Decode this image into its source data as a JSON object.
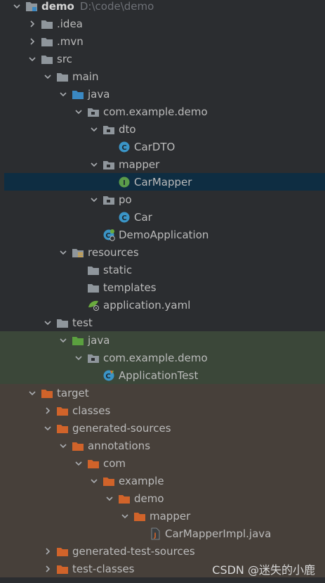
{
  "tree": [
    {
      "name": "project-root",
      "label": "demo",
      "path": "D:\\code\\demo",
      "indent": 0,
      "state": "open",
      "icon": "project-folder",
      "bold": true
    },
    {
      "name": "folder-idea",
      "label": ".idea",
      "indent": 1,
      "state": "closed",
      "icon": "folder"
    },
    {
      "name": "folder-mvn",
      "label": ".mvn",
      "indent": 1,
      "state": "closed",
      "icon": "folder"
    },
    {
      "name": "folder-src",
      "label": "src",
      "indent": 1,
      "state": "open",
      "icon": "folder"
    },
    {
      "name": "folder-main",
      "label": "main",
      "indent": 2,
      "state": "open",
      "icon": "folder"
    },
    {
      "name": "folder-java",
      "label": "java",
      "indent": 3,
      "state": "open",
      "icon": "source-folder"
    },
    {
      "name": "package-com-example-demo",
      "label": "com.example.demo",
      "indent": 4,
      "state": "open",
      "icon": "package"
    },
    {
      "name": "package-dto",
      "label": "dto",
      "indent": 5,
      "state": "open",
      "icon": "package"
    },
    {
      "name": "file-cardto",
      "label": "CarDTO",
      "indent": 6,
      "state": "none",
      "icon": "class"
    },
    {
      "name": "package-mapper",
      "label": "mapper",
      "indent": 5,
      "state": "open",
      "icon": "package"
    },
    {
      "name": "file-carmapper",
      "label": "CarMapper",
      "indent": 6,
      "state": "none",
      "icon": "interface",
      "selected": true
    },
    {
      "name": "package-po",
      "label": "po",
      "indent": 5,
      "state": "open",
      "icon": "package"
    },
    {
      "name": "file-car",
      "label": "Car",
      "indent": 6,
      "state": "none",
      "icon": "class"
    },
    {
      "name": "file-demoapplication",
      "label": "DemoApplication",
      "indent": 5,
      "state": "none",
      "icon": "spring-class"
    },
    {
      "name": "folder-resources",
      "label": "resources",
      "indent": 3,
      "state": "open",
      "icon": "resources-folder"
    },
    {
      "name": "folder-static",
      "label": "static",
      "indent": 4,
      "state": "none",
      "icon": "folder"
    },
    {
      "name": "folder-templates",
      "label": "templates",
      "indent": 4,
      "state": "none",
      "icon": "folder"
    },
    {
      "name": "file-application-yaml",
      "label": "application.yaml",
      "indent": 4,
      "state": "none",
      "icon": "yaml"
    },
    {
      "name": "folder-test",
      "label": "test",
      "indent": 2,
      "state": "open",
      "icon": "folder"
    },
    {
      "name": "folder-test-java",
      "label": "java",
      "indent": 3,
      "state": "open",
      "icon": "test-folder",
      "bg": "test"
    },
    {
      "name": "package-test-com-example-demo",
      "label": "com.example.demo",
      "indent": 4,
      "state": "open",
      "icon": "package",
      "bg": "test"
    },
    {
      "name": "file-applicationtest",
      "label": "ApplicationTest",
      "indent": 5,
      "state": "none",
      "icon": "test-class",
      "bg": "test"
    },
    {
      "name": "folder-target",
      "label": "target",
      "indent": 1,
      "state": "open",
      "icon": "excluded-folder",
      "bg": "excl"
    },
    {
      "name": "folder-classes",
      "label": "classes",
      "indent": 2,
      "state": "closed",
      "icon": "excluded-folder",
      "bg": "excl"
    },
    {
      "name": "folder-generated-sources",
      "label": "generated-sources",
      "indent": 2,
      "state": "open",
      "icon": "excluded-folder",
      "bg": "excl"
    },
    {
      "name": "folder-annotations",
      "label": "annotations",
      "indent": 3,
      "state": "open",
      "icon": "excluded-folder",
      "bg": "excl"
    },
    {
      "name": "folder-com",
      "label": "com",
      "indent": 4,
      "state": "open",
      "icon": "excluded-folder",
      "bg": "excl"
    },
    {
      "name": "folder-example",
      "label": "example",
      "indent": 5,
      "state": "open",
      "icon": "excluded-folder",
      "bg": "excl"
    },
    {
      "name": "folder-demo",
      "label": "demo",
      "indent": 6,
      "state": "open",
      "icon": "excluded-folder",
      "bg": "excl"
    },
    {
      "name": "folder-mapper-generated",
      "label": "mapper",
      "indent": 7,
      "state": "open",
      "icon": "excluded-folder",
      "bg": "excl"
    },
    {
      "name": "file-carmapperimpl-java",
      "label": "CarMapperImpl.java",
      "indent": 8,
      "state": "none",
      "icon": "java-file",
      "bg": "excl"
    },
    {
      "name": "folder-generated-test-sources",
      "label": "generated-test-sources",
      "indent": 2,
      "state": "closed",
      "icon": "excluded-folder",
      "bg": "excl"
    },
    {
      "name": "folder-test-classes",
      "label": "test-classes",
      "indent": 2,
      "state": "closed",
      "icon": "excluded-folder",
      "bg": "excl"
    }
  ],
  "watermark": "CSDN @迷失的小鹿",
  "colors": {
    "background": "#2b2d30",
    "selected": "#0e2d42",
    "test_bg": "#3b4739",
    "excluded_bg": "#47403a",
    "folder": "#8f969c",
    "source_folder": "#3a88c2",
    "test_folder": "#5ba03f",
    "excluded_folder": "#d0632a",
    "class_icon": "#3a95c7",
    "interface_icon": "#5a9c4a"
  }
}
